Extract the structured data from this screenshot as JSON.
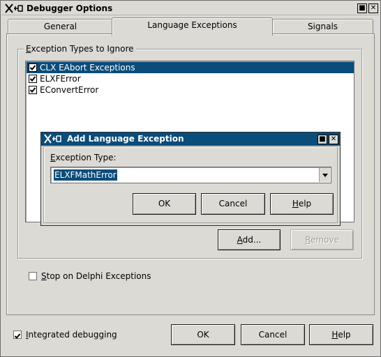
{
  "window": {
    "title": "Debugger Options"
  },
  "tabs": [
    {
      "label": "General",
      "active": false
    },
    {
      "label": "Language Exceptions",
      "active": true
    },
    {
      "label": "Signals",
      "active": false
    }
  ],
  "exceptions_group": {
    "label_access": "E",
    "label_rest": "xception Types to Ignore",
    "items": [
      {
        "label": "CLX EAbort Exceptions",
        "checked": true,
        "selected": true
      },
      {
        "label": "ELXFError",
        "checked": true,
        "selected": false
      },
      {
        "label": "EConvertError",
        "checked": true,
        "selected": false
      }
    ],
    "add_button": {
      "access": "A",
      "rest": "dd..."
    },
    "remove_button": {
      "access": "R",
      "rest": "emove"
    }
  },
  "stop_on_delphi": {
    "access": "S",
    "rest": "top on Delphi Exceptions",
    "checked": false
  },
  "footer": {
    "integrated_debugging": {
      "access": "I",
      "rest": "ntegrated debugging",
      "checked": true
    },
    "ok_label": "OK",
    "cancel_label": "Cancel",
    "help_access": "H",
    "help_rest": "elp"
  },
  "dialog": {
    "title": "Add Language Exception",
    "field_label_access": "E",
    "field_label_rest": "xception Type:",
    "field_value": "ELXFMathError",
    "ok_label": "OK",
    "cancel_label": "Cancel",
    "help_access": "H",
    "help_rest": "elp"
  },
  "colors": {
    "selection": "#0a4c7a",
    "face": "#dcdad5"
  }
}
